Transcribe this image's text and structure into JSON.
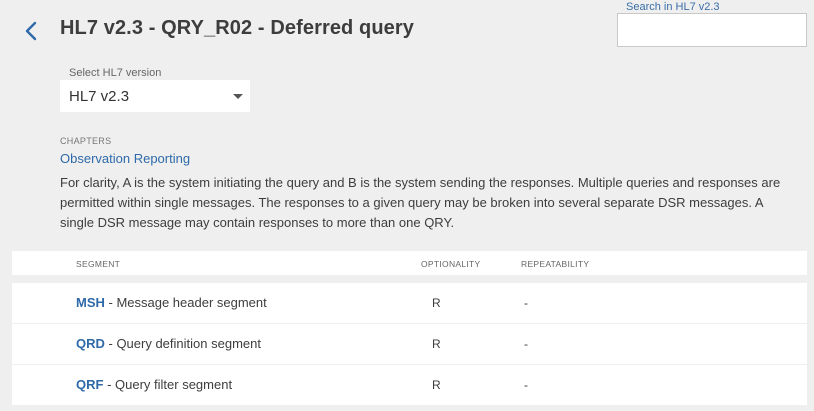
{
  "header": {
    "title": "HL7 v2.3 - QRY_R02 - Deferred query",
    "back_icon": "chevron-left-icon",
    "accent_color": "#2e69a8"
  },
  "search": {
    "label": "Search in HL7 v2.3",
    "value": "",
    "placeholder": ""
  },
  "version_select": {
    "label": "Select HL7 version",
    "selected": "HL7 v2.3",
    "icon": "caret-down-icon"
  },
  "chapters": {
    "label": "CHAPTERS",
    "link": "Observation Reporting",
    "description": "For clarity, A is the system initiating the query and B is the system sending the responses. Multiple queries and responses are permitted within single messages. The responses to a given query may be broken into several separate DSR messages. A single DSR message may contain responses to more than one QRY."
  },
  "table": {
    "columns": {
      "segment": "SEGMENT",
      "optionality": "OPTIONALITY",
      "repeatability": "REPEATABILITY"
    },
    "rows": [
      {
        "code": "MSH",
        "description": " - Message header segment",
        "optionality": "R",
        "repeatability": "-"
      },
      {
        "code": "QRD",
        "description": " - Query definition segment",
        "optionality": "R",
        "repeatability": "-"
      },
      {
        "code": "QRF",
        "description": " - Query filter segment",
        "optionality": "R",
        "repeatability": "-"
      }
    ]
  }
}
